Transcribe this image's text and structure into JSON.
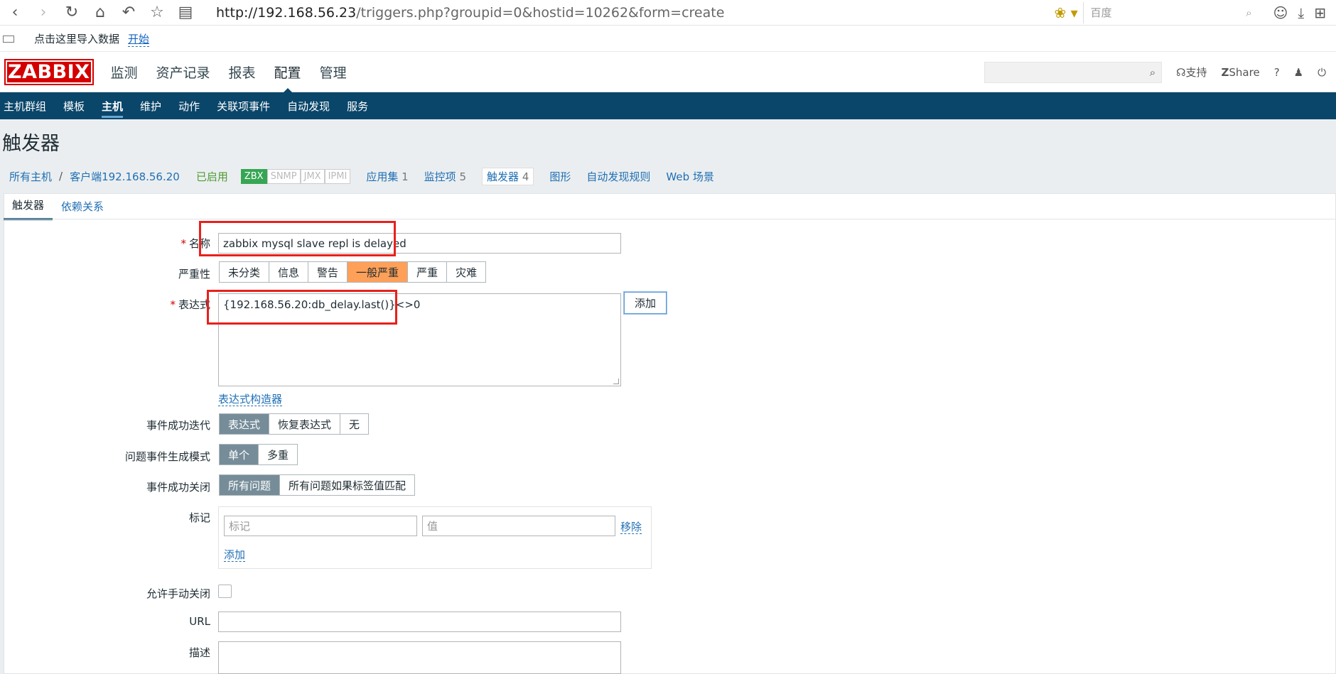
{
  "browser": {
    "url_host": "http://192.168.56.23",
    "url_rest": "/triggers.php?groupid=0&hostid=10262&form=create",
    "search_placeholder": "百度"
  },
  "bookmarks": {
    "import_text": "点击这里导入数据",
    "start_link": "开始"
  },
  "header": {
    "logo": "ZABBIX",
    "menu": [
      "监测",
      "资产记录",
      "报表",
      "配置",
      "管理"
    ],
    "support": "支持",
    "share": "Share",
    "help": "?"
  },
  "submenu": [
    "主机群组",
    "模板",
    "主机",
    "维护",
    "动作",
    "关联项事件",
    "自动发现",
    "服务"
  ],
  "page_title": "触发器",
  "host_nav": {
    "all_hosts": "所有主机",
    "sep": "/",
    "host": "客户端192.168.56.20",
    "status": "已启用",
    "badges": [
      "ZBX",
      "SNMP",
      "JMX",
      "IPMI"
    ],
    "apps": "应用集",
    "apps_count": "1",
    "items": "监控项",
    "items_count": "5",
    "triggers": "触发器",
    "triggers_count": "4",
    "graphs": "图形",
    "discovery": "自动发现规则",
    "web": "Web 场景"
  },
  "tabs": [
    "触发器",
    "依赖关系"
  ],
  "form": {
    "name_label": "名称",
    "name_value": "zabbix mysql slave repl is delayed",
    "severity_label": "严重性",
    "severity_options": [
      "未分类",
      "信息",
      "警告",
      "一般严重",
      "严重",
      "灾难"
    ],
    "expression_label": "表达式",
    "expression_value": "{192.168.56.20:db_delay.last()}<>0",
    "add_button": "添加",
    "expr_builder_link": "表达式构造器",
    "ok_event_label": "事件成功迭代",
    "ok_event_options": [
      "表达式",
      "恢复表达式",
      "无"
    ],
    "problem_mode_label": "问题事件生成模式",
    "problem_mode_options": [
      "单个",
      "多重"
    ],
    "ok_close_label": "事件成功关闭",
    "ok_close_options": [
      "所有问题",
      "所有问题如果标签值匹配"
    ],
    "tags_label": "标记",
    "tag_placeholder": "标记",
    "value_placeholder": "值",
    "remove_link": "移除",
    "add_tag_link": "添加",
    "manual_close_label": "允许手动关闭",
    "url_label": "URL",
    "desc_label": "描述"
  }
}
